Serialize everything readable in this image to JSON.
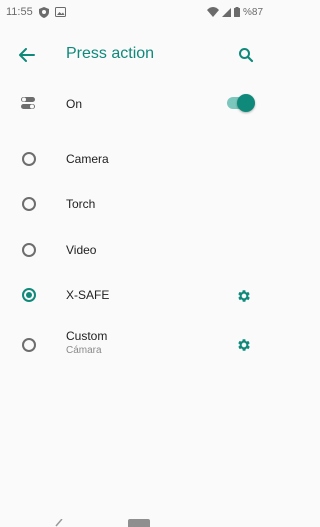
{
  "status_bar": {
    "time": "11:55",
    "battery_text": "%87"
  },
  "app_bar": {
    "title": "Press action"
  },
  "toggle_row": {
    "label": "On",
    "enabled": true
  },
  "options": [
    {
      "label": "Camera",
      "selected": false
    },
    {
      "label": "Torch",
      "selected": false
    },
    {
      "label": "Video",
      "selected": false
    },
    {
      "label": "X-SAFE",
      "selected": true,
      "has_settings": true
    },
    {
      "label": "Custom",
      "sublabel": "Cámara",
      "selected": false,
      "has_settings": true
    }
  ],
  "colors": {
    "accent": "#0f8a7a",
    "text": "#212121",
    "secondary_text": "#8a8a8a",
    "background": "#fafafa"
  },
  "icons": [
    "back-arrow-icon",
    "search-icon",
    "switch-settings-icon",
    "gear-icon",
    "shield-icon",
    "image-icon",
    "wifi-icon",
    "signal-icon",
    "battery-icon"
  ]
}
